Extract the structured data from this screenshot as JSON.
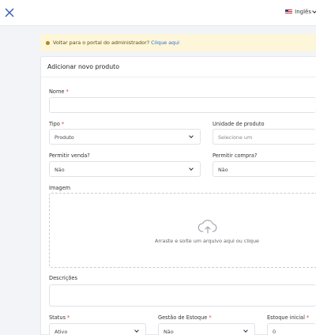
{
  "topbar": {
    "language": "Inglês"
  },
  "notice": {
    "text": "Voltar para o portal do administrador?",
    "link": "Clique aqui"
  },
  "form": {
    "title": "Adicionar novo produto",
    "name": {
      "label": "Nome",
      "value": ""
    },
    "type": {
      "label": "Tipo",
      "value": "Produto"
    },
    "unit": {
      "label": "Unidade de produto",
      "placeholder": "Selecione um"
    },
    "allow_sale": {
      "label": "Permitir venda?",
      "value": "Não"
    },
    "allow_purchase": {
      "label": "Permitir compra?",
      "value": "Não"
    },
    "image": {
      "label": "Imagem",
      "dropzone_text": "Arraste e solte um arquivo aqui ou clique"
    },
    "descriptions": {
      "label": "Descrições",
      "value": ""
    },
    "status": {
      "label": "Status",
      "value": "Ativo"
    },
    "stock_management": {
      "label": "Gestão de Estoque",
      "value": "Não"
    },
    "initial_stock": {
      "label": "Estoque inicial",
      "value": "0"
    }
  },
  "colors": {
    "primary": "#2f6fd6",
    "required": "#e03b3b",
    "notice_bg": "#fdf6d8"
  }
}
